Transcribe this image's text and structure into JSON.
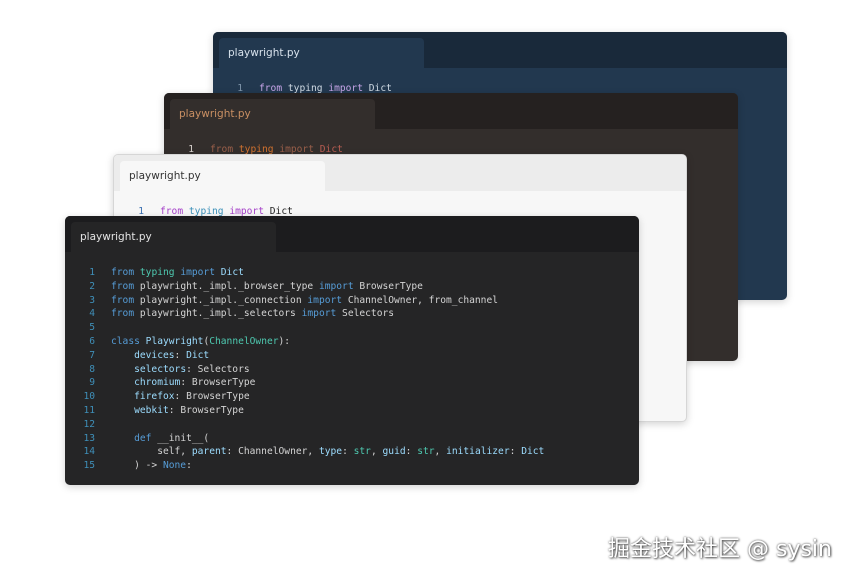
{
  "windows": [
    {
      "tab": "playwright.py",
      "line_no": "1",
      "tokens": {
        "kw1": "from",
        "mod": "typing",
        "kw2": "import",
        "type": "Dict"
      }
    },
    {
      "tab": "playwright.py",
      "line_no": "1",
      "tokens": {
        "kw1": "from",
        "mod": "typing",
        "kw2": "import",
        "type": "Dict"
      }
    },
    {
      "tab": "playwright.py",
      "line_no": "1",
      "tokens": {
        "kw1": "from",
        "mod": "typing",
        "kw2": "import",
        "type": "Dict"
      }
    }
  ],
  "front": {
    "tab": "playwright.py",
    "lines": [
      {
        "n": "1",
        "parts": [
          [
            "c-def",
            "from"
          ],
          [
            "c-plain",
            " "
          ],
          [
            "c-mod",
            "typing"
          ],
          [
            "c-plain",
            " "
          ],
          [
            "c-def",
            "import"
          ],
          [
            "c-plain",
            " "
          ],
          [
            "c-attr",
            "Dict"
          ]
        ]
      },
      {
        "n": "2",
        "parts": [
          [
            "c-def",
            "from"
          ],
          [
            "c-plain",
            " playwright._impl._browser_type "
          ],
          [
            "c-def",
            "import"
          ],
          [
            "c-plain",
            " BrowserType"
          ]
        ]
      },
      {
        "n": "3",
        "parts": [
          [
            "c-def",
            "from"
          ],
          [
            "c-plain",
            " playwright._impl._connection "
          ],
          [
            "c-def",
            "import"
          ],
          [
            "c-plain",
            " ChannelOwner, from_channel"
          ]
        ]
      },
      {
        "n": "4",
        "parts": [
          [
            "c-def",
            "from"
          ],
          [
            "c-plain",
            " playwright._impl._selectors "
          ],
          [
            "c-def",
            "import"
          ],
          [
            "c-plain",
            " Selectors"
          ]
        ]
      },
      {
        "n": "5",
        "parts": []
      },
      {
        "n": "6",
        "parts": [
          [
            "c-def",
            "class"
          ],
          [
            "c-plain",
            " "
          ],
          [
            "c-attr",
            "Playwright"
          ],
          [
            "c-plain",
            "("
          ],
          [
            "c-cls",
            "ChannelOwner"
          ],
          [
            "c-plain",
            "):"
          ]
        ]
      },
      {
        "n": "7",
        "parts": [
          [
            "c-plain",
            "    "
          ],
          [
            "c-attr",
            "devices"
          ],
          [
            "c-plain",
            ": "
          ],
          [
            "c-attr",
            "Dict"
          ]
        ]
      },
      {
        "n": "8",
        "parts": [
          [
            "c-plain",
            "    "
          ],
          [
            "c-attr",
            "selectors"
          ],
          [
            "c-plain",
            ": Selectors"
          ]
        ]
      },
      {
        "n": "9",
        "parts": [
          [
            "c-plain",
            "    "
          ],
          [
            "c-attr",
            "chromium"
          ],
          [
            "c-plain",
            ": BrowserType"
          ]
        ]
      },
      {
        "n": "10",
        "parts": [
          [
            "c-plain",
            "    "
          ],
          [
            "c-attr",
            "firefox"
          ],
          [
            "c-plain",
            ": BrowserType"
          ]
        ]
      },
      {
        "n": "11",
        "parts": [
          [
            "c-plain",
            "    "
          ],
          [
            "c-attr",
            "webkit"
          ],
          [
            "c-plain",
            ": BrowserType"
          ]
        ]
      },
      {
        "n": "12",
        "parts": []
      },
      {
        "n": "13",
        "parts": [
          [
            "c-plain",
            "    "
          ],
          [
            "c-def",
            "def"
          ],
          [
            "c-plain",
            " __init__("
          ]
        ]
      },
      {
        "n": "14",
        "parts": [
          [
            "c-plain",
            "        self, "
          ],
          [
            "c-attr",
            "parent"
          ],
          [
            "c-plain",
            ": ChannelOwner, "
          ],
          [
            "c-attr",
            "type"
          ],
          [
            "c-plain",
            ": "
          ],
          [
            "c-mod",
            "str"
          ],
          [
            "c-plain",
            ", "
          ],
          [
            "c-attr",
            "guid"
          ],
          [
            "c-plain",
            ": "
          ],
          [
            "c-mod",
            "str"
          ],
          [
            "c-plain",
            ", "
          ],
          [
            "c-attr",
            "initializer"
          ],
          [
            "c-plain",
            ": "
          ],
          [
            "c-attr",
            "Dict"
          ]
        ]
      },
      {
        "n": "15",
        "parts": [
          [
            "c-plain",
            "    ) -> "
          ],
          [
            "c-def",
            "None"
          ],
          [
            "c-plain",
            ":"
          ]
        ]
      }
    ]
  },
  "watermark": "掘金技术社区 @ sysin"
}
